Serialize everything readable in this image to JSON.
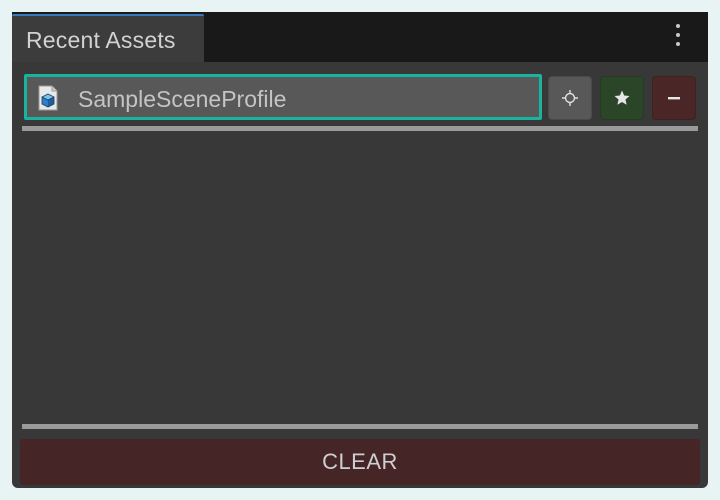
{
  "window": {
    "tab_title": "Recent Assets",
    "menu_icon": "kebab-menu-icon"
  },
  "items": [
    {
      "name": "SampleSceneProfile",
      "icon": "scriptable-object-icon",
      "selected": true
    }
  ],
  "actions": {
    "ping_icon": "crosshair-icon",
    "favorite_icon": "star-icon",
    "remove_icon": "minus-icon",
    "clear_label": "CLEAR"
  },
  "colors": {
    "selection_outline": "#19b4a0",
    "favorite_button": "#2b4528",
    "remove_button": "#4a2626",
    "clear_button": "#452526",
    "tab_accent": "#3a79bb"
  }
}
